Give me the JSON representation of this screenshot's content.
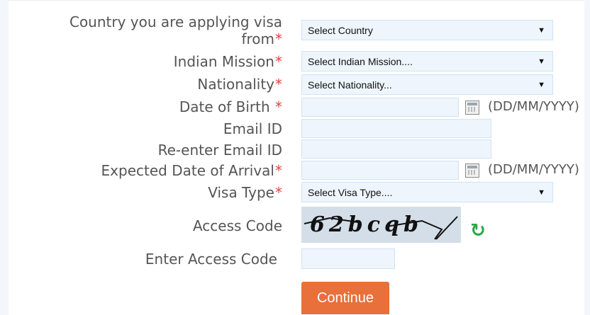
{
  "form": {
    "country": {
      "label_line1": "Country you are applying visa",
      "label_line2": "from",
      "required": "*",
      "value": "Select Country"
    },
    "mission": {
      "label": "Indian Mission",
      "required": "*",
      "value": "Select Indian Mission...."
    },
    "nationality": {
      "label": "Nationality",
      "required": "*",
      "value": "Select Nationality..."
    },
    "dob": {
      "label": "Date of Birth ",
      "required": "*",
      "format": "(DD/MM/YYYY)"
    },
    "email": {
      "label": "Email ID"
    },
    "email_confirm": {
      "label": "Re-enter Email ID"
    },
    "arrival": {
      "label": "Expected Date of Arrival",
      "required": "*",
      "format": "(DD/MM/YYYY)"
    },
    "visa_type": {
      "label": "Visa Type",
      "required": "*",
      "value": "Select Visa Type...."
    },
    "access_code": {
      "label": "Access Code",
      "captcha_text": "62bcqb"
    },
    "enter_access_code": {
      "label": "Enter Access Code"
    },
    "continue_label": "Continue"
  },
  "icons": {
    "dropdown": "caret-down-icon",
    "calendar": "calendar-icon",
    "refresh": "refresh-icon"
  },
  "colors": {
    "required": "#e8423b",
    "field_bg": "#eef5fc",
    "button": "#e8703a",
    "refresh": "#2aa84a"
  }
}
